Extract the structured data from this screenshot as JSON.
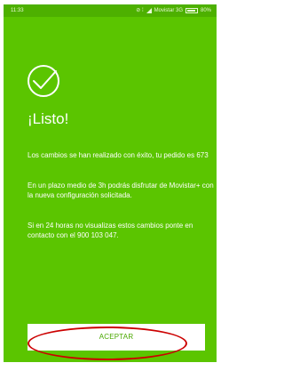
{
  "status_bar": {
    "time": "11:33",
    "status_icons": "⊘ ⁞",
    "carrier": "Movistar 3G",
    "battery": "80%",
    "signal_icon": "signal-icon",
    "battery_icon": "battery-icon"
  },
  "confirmation": {
    "icon": "check-icon",
    "title": "¡Listo!",
    "message_1": "Los cambios se han realizado con éxito, tu pedido es 673",
    "message_2": "En un plazo medio de 3h podrás disfrutar de Movistar+ con la nueva configuración solicitada.",
    "message_3": "Si en 24 horas no visualizas estos cambios ponte en contacto con el 900 103 047."
  },
  "footer": {
    "accept_label": "ACEPTAR"
  },
  "colors": {
    "background": "#5bc500",
    "text": "#ffffff",
    "button_text": "#4aa800",
    "highlight": "#cc0000"
  }
}
